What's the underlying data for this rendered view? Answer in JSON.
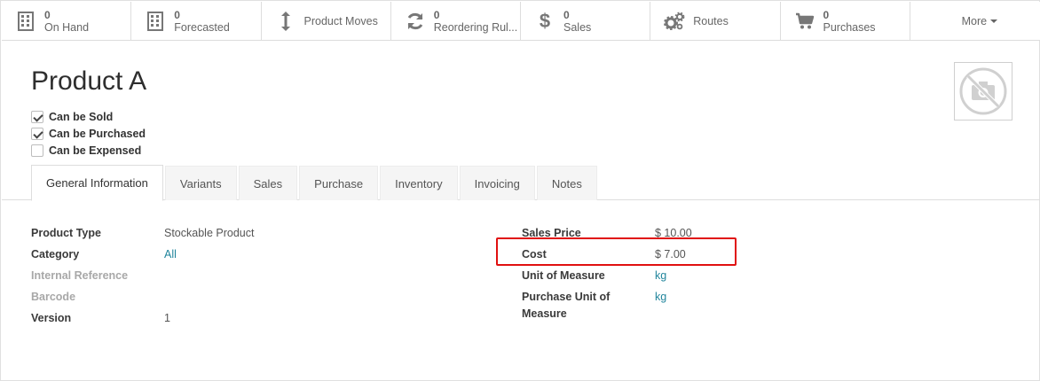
{
  "smart_buttons": [
    {
      "value": "0",
      "label": "On Hand",
      "icon": "building-icon"
    },
    {
      "value": "0",
      "label": "Forecasted",
      "icon": "building-icon"
    },
    {
      "label": "Product Moves",
      "icon": "arrows-vertical-icon"
    },
    {
      "value": "0",
      "label": "Reordering Rul...",
      "icon": "refresh-icon"
    },
    {
      "value": "0",
      "label": "Sales",
      "icon": "dollar-icon"
    },
    {
      "label": "Routes",
      "icon": "cogs-icon"
    },
    {
      "value": "0",
      "label": "Purchases",
      "icon": "shopping-cart-icon"
    },
    {
      "label": "More"
    }
  ],
  "product": {
    "name": "Product A",
    "photo_icon": "no-camera-icon"
  },
  "checkboxes": [
    {
      "label": "Can be Sold",
      "checked": true
    },
    {
      "label": "Can be Purchased",
      "checked": true
    },
    {
      "label": "Can be Expensed",
      "checked": false
    }
  ],
  "tabs": [
    {
      "label": "General Information",
      "active": true
    },
    {
      "label": "Variants"
    },
    {
      "label": "Sales"
    },
    {
      "label": "Purchase"
    },
    {
      "label": "Inventory"
    },
    {
      "label": "Invoicing"
    },
    {
      "label": "Notes"
    }
  ],
  "left_fields": [
    {
      "label": "Product Type",
      "value": "Stockable Product"
    },
    {
      "label": "Category",
      "value": "All"
    },
    {
      "label": "Internal Reference",
      "value": ""
    },
    {
      "label": "Barcode",
      "value": ""
    },
    {
      "label": "Version",
      "value": "1"
    }
  ],
  "right_fields": [
    {
      "label": "Sales Price",
      "value": "$ 10.00"
    },
    {
      "label": "Cost",
      "value": "$ 7.00"
    },
    {
      "label": "Unit of Measure",
      "value": "kg"
    },
    {
      "label": "Purchase Unit of Measure",
      "value": "kg"
    }
  ],
  "colors": {
    "link": "#21859c",
    "highlight": "#e01010"
  }
}
